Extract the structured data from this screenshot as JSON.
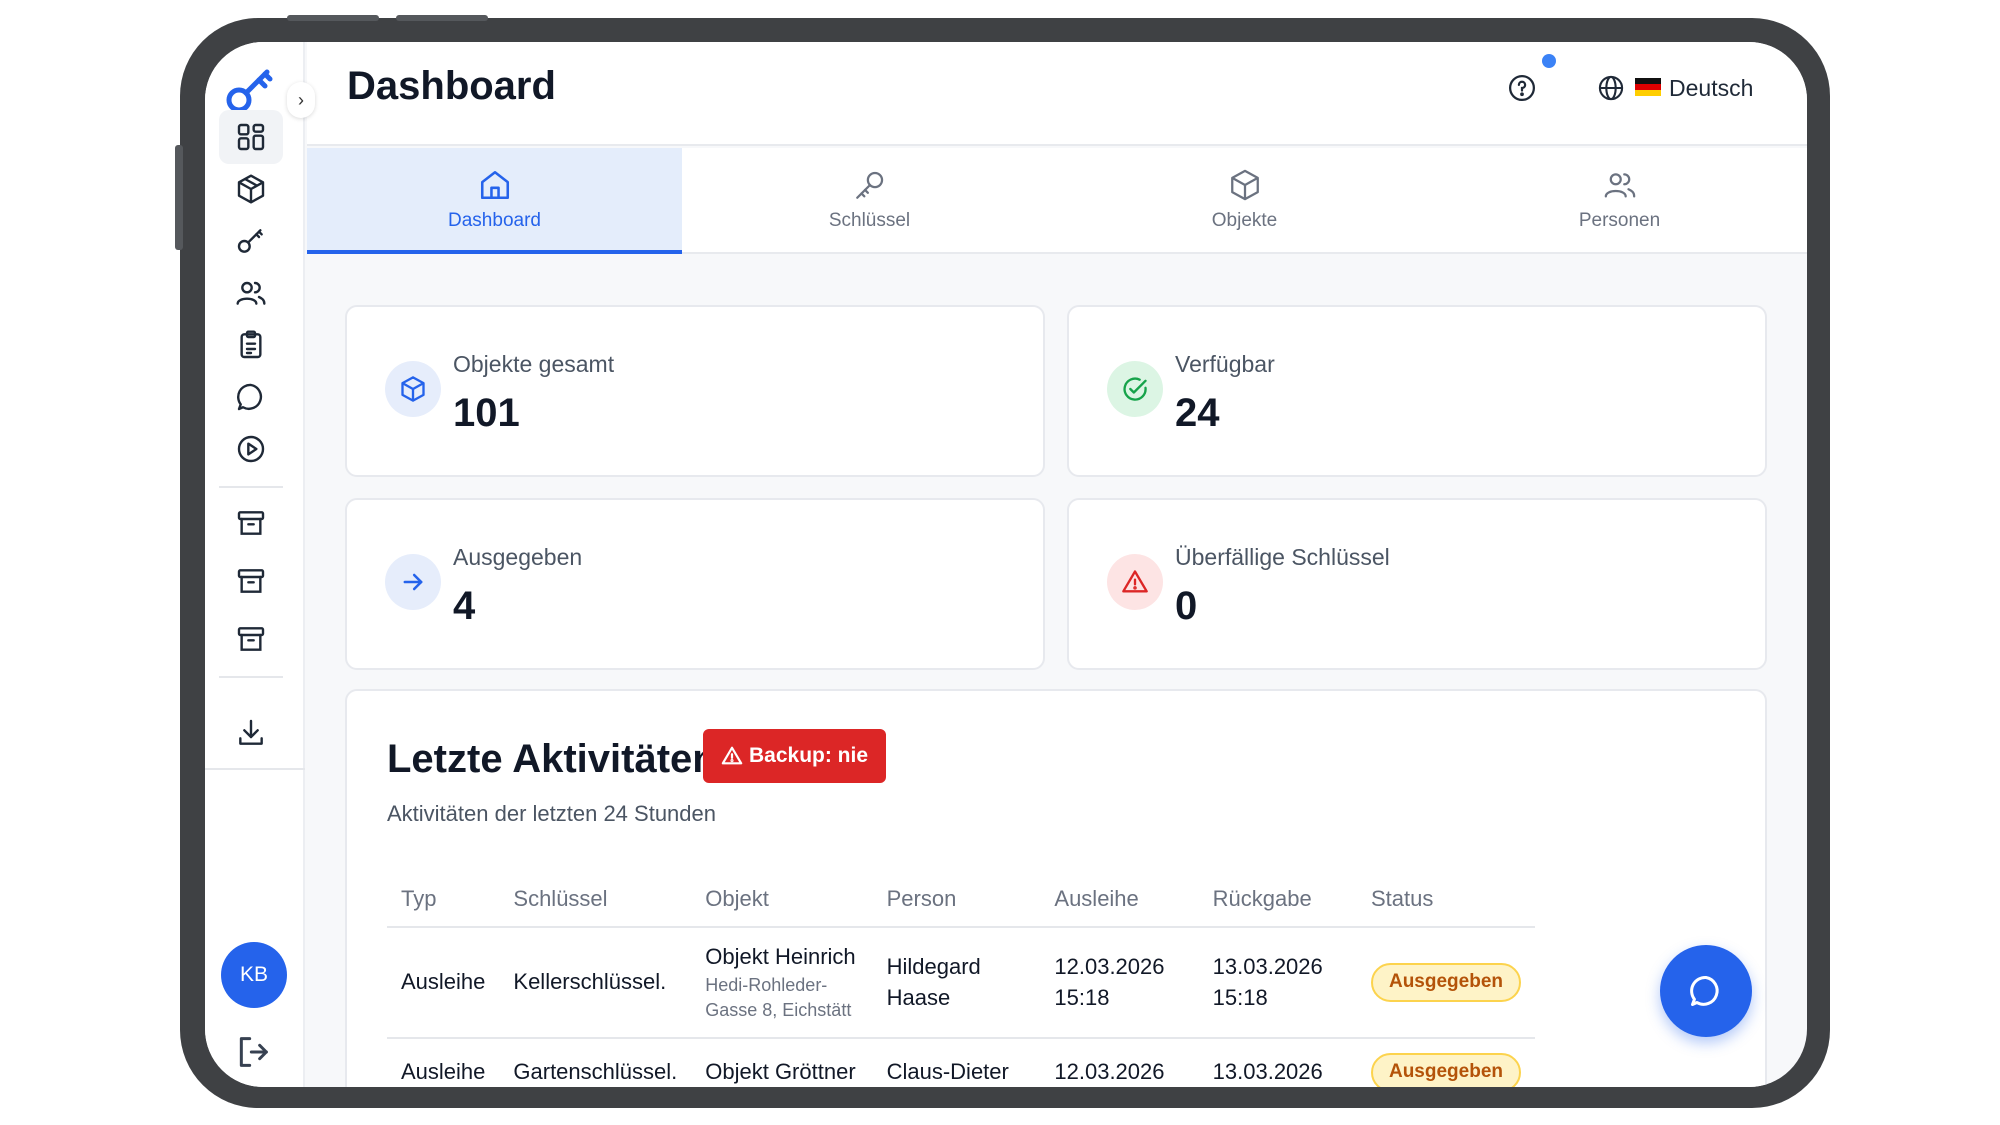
{
  "header": {
    "title": "Dashboard",
    "language": "Deutsch",
    "help_icon": "help-circle-icon",
    "globe_icon": "globe-icon"
  },
  "sidebar": {
    "collapse_glyph": "›",
    "items": [
      {
        "icon": "dashboard-grid-icon"
      },
      {
        "icon": "box-icon"
      },
      {
        "icon": "key-icon"
      },
      {
        "icon": "users-icon"
      },
      {
        "icon": "clipboard-icon"
      },
      {
        "icon": "message-icon"
      },
      {
        "icon": "play-circle-icon"
      },
      {
        "icon": "archive-icon"
      },
      {
        "icon": "archive-icon"
      },
      {
        "icon": "archive-icon"
      },
      {
        "icon": "download-icon"
      }
    ],
    "avatar_initials": "KB",
    "logout_icon": "logout-icon"
  },
  "tabs": [
    {
      "label": "Dashboard",
      "icon": "home-icon",
      "active": true
    },
    {
      "label": "Schlüssel",
      "icon": "key-icon",
      "active": false
    },
    {
      "label": "Objekte",
      "icon": "box-icon",
      "active": false
    },
    {
      "label": "Personen",
      "icon": "users-icon",
      "active": false
    }
  ],
  "stats": [
    {
      "label": "Objekte gesamt",
      "value": "101",
      "icon": "box-icon",
      "color": "#2563eb",
      "bg": "#e6edfb"
    },
    {
      "label": "Verfügbar",
      "value": "24",
      "icon": "check-circle-icon",
      "color": "#16a34a",
      "bg": "#dcf5e4"
    },
    {
      "label": "Ausgegeben",
      "value": "4",
      "icon": "arrow-right-icon",
      "color": "#2563eb",
      "bg": "#e6edfb"
    },
    {
      "label": "Überfällige Schlüssel",
      "value": "0",
      "icon": "alert-triangle-icon",
      "color": "#dc2626",
      "bg": "#fde4e4"
    }
  ],
  "activity": {
    "title": "Letzte Aktivitäten",
    "backup_badge": "Backup: nie",
    "subtitle": "Aktivitäten der letzten 24 Stunden",
    "columns": [
      "Typ",
      "Schlüssel",
      "Objekt",
      "Person",
      "Ausleihe",
      "Rückgabe",
      "Status"
    ],
    "rows": [
      {
        "typ": "Ausleihe",
        "schluessel": "Kellerschlüssel.",
        "objekt": "Objekt Heinrich",
        "adresse": "Hedi-Rohleder-Gasse 8, Eichstätt",
        "person": "Hildegard Haase",
        "ausleihe_date": "12.03.2026",
        "ausleihe_time": "15:18",
        "rueckgabe_date": "13.03.2026",
        "rueckgabe_time": "15:18",
        "status": "Ausgegeben"
      },
      {
        "typ": "Ausleihe",
        "schluessel": "Gartenschlüssel.",
        "objekt": "Objekt Gröttner",
        "adresse": "",
        "person": "Claus-Dieter",
        "ausleihe_date": "12.03.2026",
        "ausleihe_time": "",
        "rueckgabe_date": "13.03.2026",
        "rueckgabe_time": "",
        "status": "Ausgegeben"
      }
    ]
  },
  "chat_icon": "chat-bubble-icon",
  "colors": {
    "accent": "#2563eb",
    "danger": "#dc2626",
    "frame": "#3f4144"
  }
}
